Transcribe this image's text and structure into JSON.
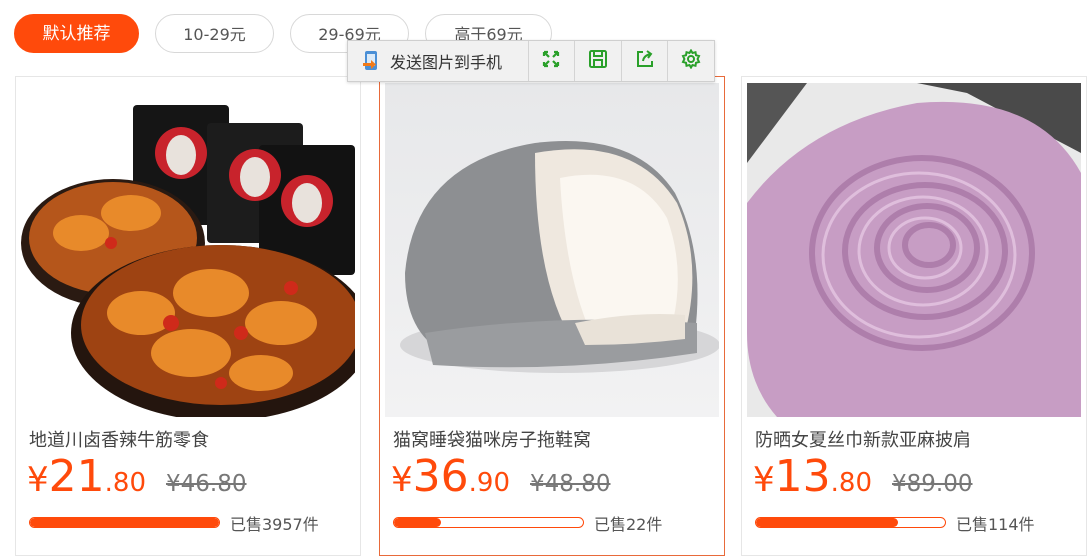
{
  "filters": [
    {
      "label": "默认推荐",
      "active": true
    },
    {
      "label": "10-29元",
      "active": false
    },
    {
      "label": "29-69元",
      "active": false
    },
    {
      "label": "高于69元",
      "active": false
    }
  ],
  "toolbar": {
    "send_label": "发送图片到手机",
    "icons": [
      "send-to-phone-icon",
      "expand-icon",
      "save-icon",
      "share-icon",
      "settings-icon"
    ]
  },
  "products": [
    {
      "title": "地道川卤香辣牛筋零食",
      "currency": "¥",
      "price_int": "21",
      "price_dec": ".80",
      "original": "¥46.80",
      "sold_text": "已售3957件",
      "sold_progress": 1.0
    },
    {
      "title": "猫窝睡袋猫咪房子拖鞋窝",
      "currency": "¥",
      "price_int": "36",
      "price_dec": ".90",
      "original": "¥48.80",
      "sold_text": "已售22件",
      "sold_progress": 0.25
    },
    {
      "title": "防晒女夏丝巾新款亚麻披肩",
      "currency": "¥",
      "price_int": "13",
      "price_dec": ".80",
      "original": "¥89.00",
      "sold_text": "已售114件",
      "sold_progress": 0.75
    }
  ],
  "colors": {
    "accent": "#ff4a0b",
    "toolbar_green": "#2aa02a"
  }
}
